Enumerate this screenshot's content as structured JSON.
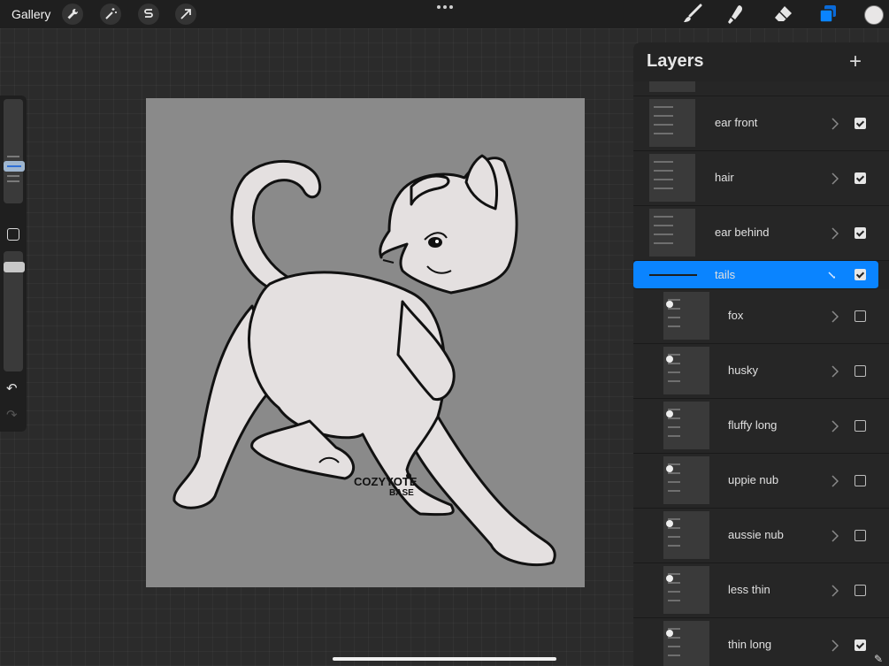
{
  "topbar": {
    "gallery_label": "Gallery",
    "left_tools": [
      "wrench-icon",
      "magic-wand-icon",
      "selection-s-icon",
      "transform-arrow-icon"
    ],
    "right_tools": [
      "brush-icon",
      "smudge-icon",
      "eraser-icon",
      "layers-icon"
    ],
    "active_tool": "layers-icon",
    "current_color": "#e8e6e6",
    "accent_color": "#0a84ff"
  },
  "canvas": {
    "background_color": "#8a8a8a",
    "watermark_line1": "COZYYOTE",
    "watermark_line2": "BASE"
  },
  "layers_panel": {
    "title": "Layers",
    "add_icon": "plus-icon",
    "layers": [
      {
        "name": "ear front",
        "visible": true,
        "kind": "group",
        "expanded": false
      },
      {
        "name": "hair",
        "visible": true,
        "kind": "group",
        "expanded": false
      },
      {
        "name": "ear behind",
        "visible": true,
        "kind": "group",
        "expanded": false
      },
      {
        "name": "tails",
        "visible": true,
        "kind": "group",
        "expanded": true,
        "selected": true
      },
      {
        "name": "fox",
        "visible": false,
        "kind": "group",
        "expanded": false
      },
      {
        "name": "husky",
        "visible": false,
        "kind": "group",
        "expanded": false
      },
      {
        "name": "fluffy long",
        "visible": false,
        "kind": "group",
        "expanded": false
      },
      {
        "name": "uppie nub",
        "visible": false,
        "kind": "group",
        "expanded": false
      },
      {
        "name": "aussie nub",
        "visible": false,
        "kind": "group",
        "expanded": false
      },
      {
        "name": "less thin",
        "visible": false,
        "kind": "group",
        "expanded": false
      },
      {
        "name": "thin long",
        "visible": true,
        "kind": "group",
        "expanded": false
      }
    ]
  }
}
